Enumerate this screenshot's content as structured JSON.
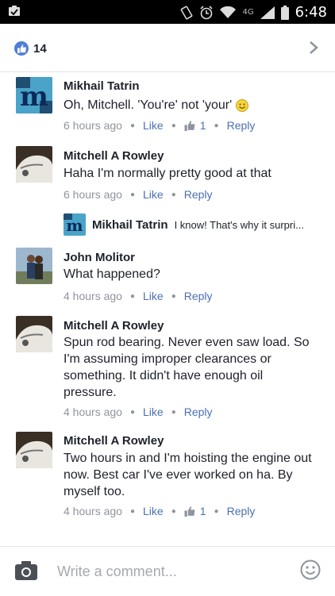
{
  "status_bar": {
    "time": "6:48",
    "network": "4G"
  },
  "header": {
    "like_count": "14"
  },
  "comments": [
    {
      "name": "Mikhail Tatrin",
      "text": "Oh, Mitchell. 'You're' not 'your'",
      "time": "6 hours ago",
      "like_label": "Like",
      "like_count": "1",
      "reply_label": "Reply"
    },
    {
      "name": "Mitchell A Rowley",
      "text": "Haha I'm normally pretty good at that",
      "time": "6 hours ago",
      "like_label": "Like",
      "reply_label": "Reply"
    },
    {
      "name": "John Molitor",
      "text": "What happened?",
      "time": "4 hours ago",
      "like_label": "Like",
      "reply_label": "Reply"
    },
    {
      "name": "Mitchell A Rowley",
      "text": "Spun rod bearing. Never even saw load. So I'm assuming improper clearances or something. It didn't have enough oil pressure.",
      "time": "4 hours ago",
      "like_label": "Like",
      "reply_label": "Reply"
    },
    {
      "name": "Mitchell A Rowley",
      "text": "Two hours in and I'm hoisting the engine out now. Best car I've ever worked on ha. By myself too.",
      "time": "4 hours ago",
      "like_label": "Like",
      "like_count": "1",
      "reply_label": "Reply"
    }
  ],
  "reply_preview": {
    "name": "Mikhail Tatrin",
    "text": "I know! That's why it surpri..."
  },
  "composer": {
    "placeholder": "Write a comment..."
  },
  "colors": {
    "link": "#4b6fb3",
    "meta": "#90949c",
    "like_badge": "#4f7ed7"
  }
}
